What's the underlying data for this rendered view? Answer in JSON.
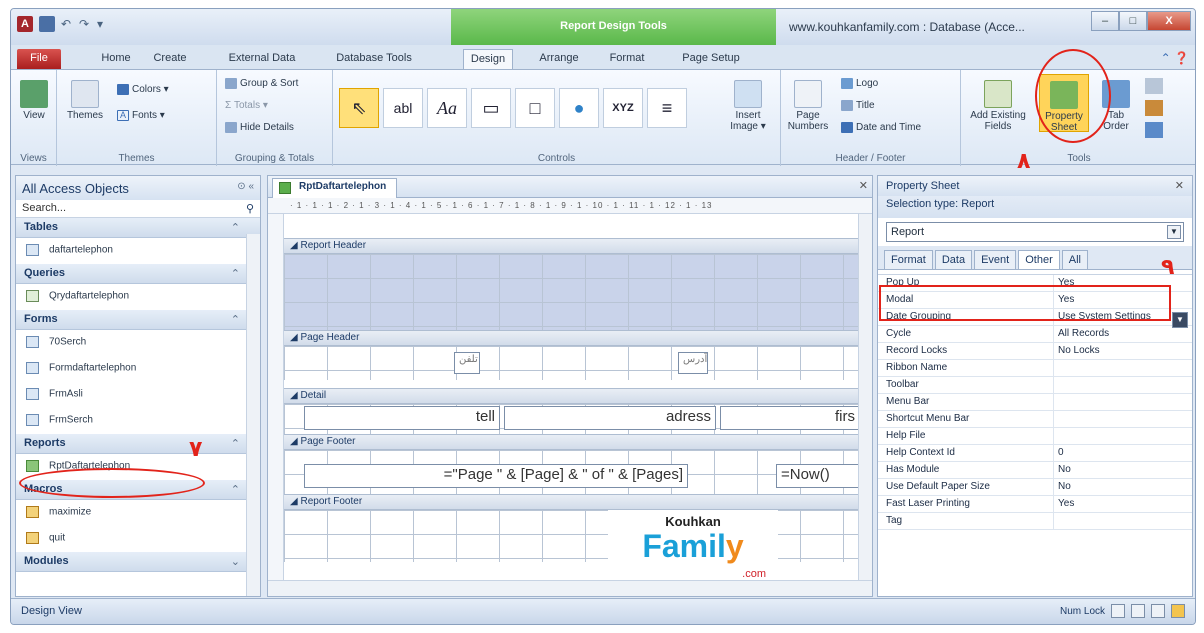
{
  "window": {
    "title": "www.kouhkanfamily.com : Database (Acce...",
    "context_tab": "Report Design Tools",
    "controls": {
      "minimize": "–",
      "maximize": "□",
      "close": "X"
    }
  },
  "tabs": [
    "File",
    "Home",
    "Create",
    "External Data",
    "Database Tools",
    "Design",
    "Arrange",
    "Format",
    "Page Setup"
  ],
  "ribbon": {
    "views": {
      "view_label": "View",
      "group": "Views"
    },
    "themes": {
      "themes_label": "Themes",
      "colors_label": "Colors ▾",
      "fonts_label": "Fonts ▾",
      "fonts_btn": "A",
      "group": "Themes"
    },
    "grouping": {
      "group_sort": "Group & Sort",
      "totals": "Σ Totals ▾",
      "hide_details": "Hide Details",
      "group": "Grouping & Totals"
    },
    "controls": {
      "insert_image": "Insert",
      "insert_image2": "Image ▾",
      "group": "Controls",
      "items": [
        "⇖",
        "abl",
        "Aa",
        "▭",
        "□",
        "●",
        "XYZ",
        "≡"
      ]
    },
    "header_footer": {
      "logo": "Logo",
      "title": "Title",
      "date_time": "Date and Time",
      "page_numbers": "Page",
      "page_numbers2": "Numbers",
      "group": "Header / Footer"
    },
    "tools": {
      "add_existing": "Add Existing",
      "add_existing2": "Fields",
      "property_sheet": "Property",
      "property_sheet2": "Sheet",
      "tab_order": "Tab",
      "tab_order2": "Order",
      "group": "Tools"
    }
  },
  "nav": {
    "title": "All Access Objects",
    "search_placeholder": "Search...",
    "sections": [
      {
        "name": "Tables",
        "items": [
          "daftartelephon"
        ]
      },
      {
        "name": "Queries",
        "items": [
          "Qrydaftartelephon"
        ]
      },
      {
        "name": "Forms",
        "items": [
          "70Serch",
          "Formdaftartelephon",
          "FrmAsli",
          "FrmSerch"
        ]
      },
      {
        "name": "Reports",
        "items": [
          "RptDaftartelephon"
        ]
      },
      {
        "name": "Macros",
        "items": [
          "maximize",
          "quit"
        ]
      },
      {
        "name": "Modules",
        "items": []
      }
    ]
  },
  "document": {
    "tab_title": "RptDaftartelephon",
    "ruler": "· 1 · 1 · 1 · 2 · 1 · 3 · 1 · 4 · 1 · 5 · 1 · 6 · 1 · 7 · 1 · 8 · 1 · 9 · 1 · 10 · 1 · 11 · 1 · 12 · 1 · 13",
    "bands": [
      "Report Header",
      "Page Header",
      "Detail",
      "Page Footer",
      "Report Footer"
    ],
    "page_header_labels": [
      "تلفن",
      "آدرس"
    ],
    "detail_fields": [
      "tell",
      "adress",
      "firs"
    ],
    "footer_expr": "=\"Page \" & [Page] & \" of \" & [Pages]",
    "footer_now": "=Now()",
    "logo": {
      "top": "Kouhkan",
      "main_a": "Famil",
      "main_b": "y",
      "suffix": ".com"
    }
  },
  "property_sheet": {
    "title": "Property Sheet",
    "selection_type": "Selection type: Report",
    "selected_object": "Report",
    "tabs": [
      "Format",
      "Data",
      "Event",
      "Other",
      "All"
    ],
    "active_tab": "Other",
    "rows": [
      {
        "name": "Pop Up",
        "value": "Yes"
      },
      {
        "name": "Modal",
        "value": "Yes"
      },
      {
        "name": "Date Grouping",
        "value": "Use System Settings"
      },
      {
        "name": "Cycle",
        "value": "All Records"
      },
      {
        "name": "Record Locks",
        "value": "No Locks"
      },
      {
        "name": "Ribbon Name",
        "value": ""
      },
      {
        "name": "Toolbar",
        "value": ""
      },
      {
        "name": "Menu Bar",
        "value": ""
      },
      {
        "name": "Shortcut Menu Bar",
        "value": ""
      },
      {
        "name": "Help File",
        "value": ""
      },
      {
        "name": "Help Context Id",
        "value": "0"
      },
      {
        "name": "Has Module",
        "value": "No"
      },
      {
        "name": "Use Default Paper Size",
        "value": "No"
      },
      {
        "name": "Fast Laser Printing",
        "value": "Yes"
      },
      {
        "name": "Tag",
        "value": ""
      }
    ]
  },
  "annotations": {
    "seven": "۷",
    "eight": "۸",
    "nine": "۹"
  },
  "status": {
    "left": "Design View",
    "num_lock": "Num Lock"
  },
  "colors": {
    "accent_red": "#e2231a",
    "context_green": "#5ab84a",
    "file_red": "#a91e1e"
  }
}
